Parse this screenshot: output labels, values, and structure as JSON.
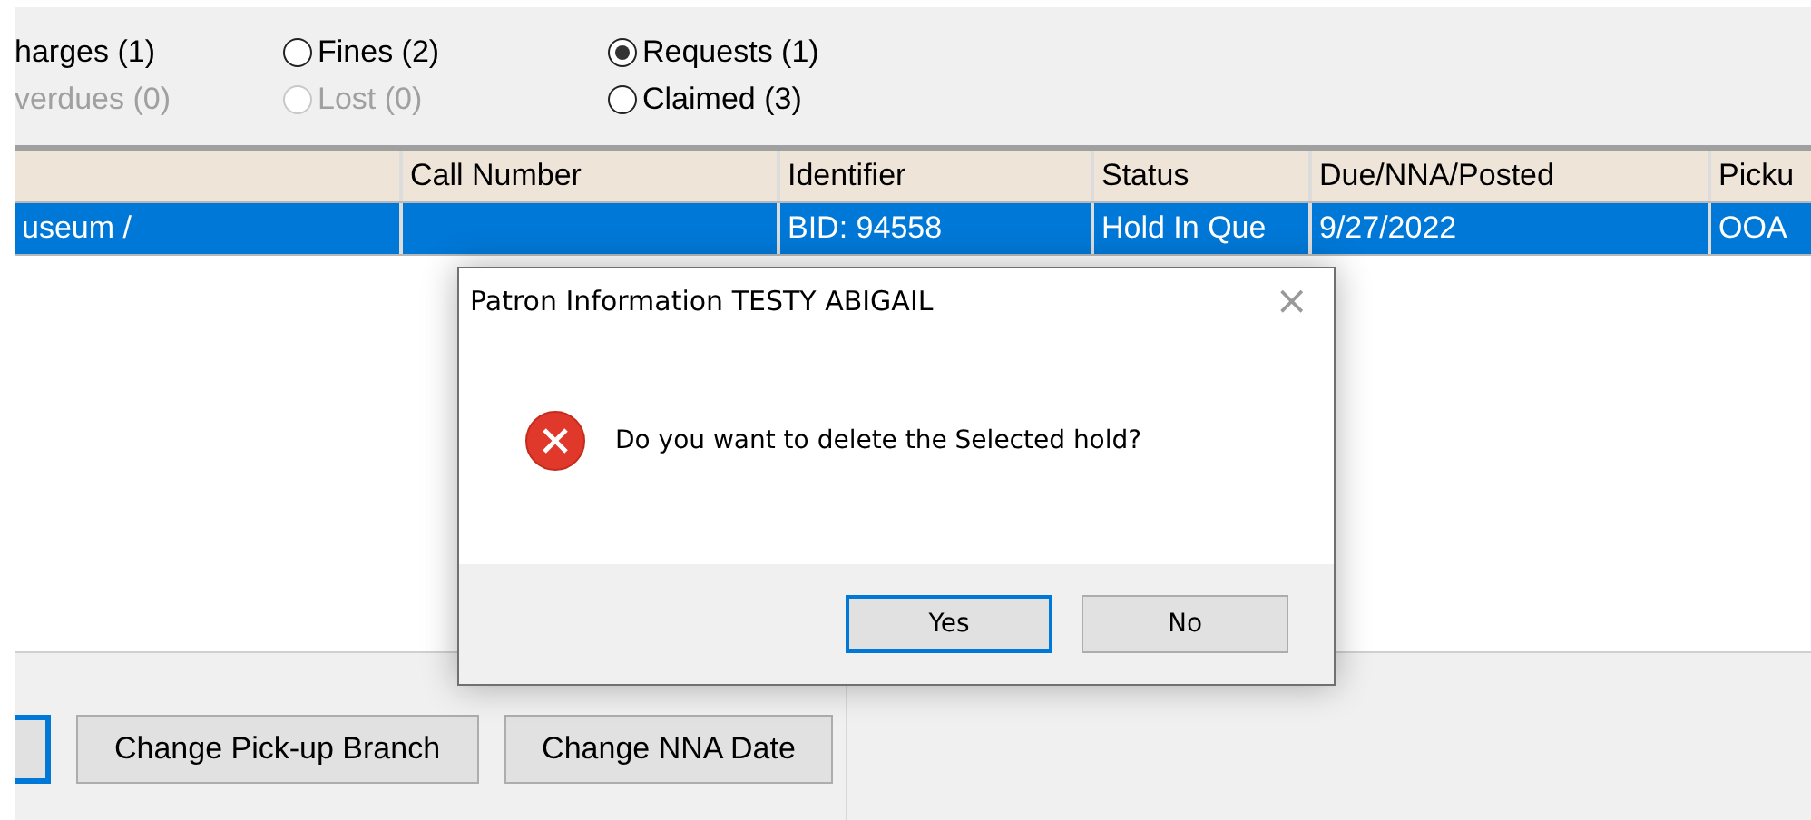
{
  "filters": [
    {
      "label": "harges (1)",
      "kind": "clipped",
      "disabled": false
    },
    {
      "label": "verdues (0)",
      "kind": "clipped",
      "disabled": true
    },
    {
      "label": "Fines (2)",
      "kind": "radio",
      "selected": false,
      "disabled": false
    },
    {
      "label": "Lost (0)",
      "kind": "radio",
      "selected": false,
      "disabled": true
    },
    {
      "label": "Requests (1)",
      "kind": "radio",
      "selected": true,
      "disabled": false
    },
    {
      "label": "Claimed (3)",
      "kind": "radio",
      "selected": false,
      "disabled": false
    }
  ],
  "table": {
    "columns": [
      "",
      "Call Number",
      "Identifier",
      "Status",
      "Due/NNA/Posted",
      "Picku"
    ],
    "rows": [
      {
        "selected": true,
        "cells": [
          "useum /",
          "",
          "BID: 94558",
          "Hold In Que",
          "9/27/2022",
          "OOA"
        ]
      }
    ]
  },
  "actions": [
    {
      "focused": true
    },
    {
      "label": "Change Pick-up Branch",
      "focused": false
    },
    {
      "label": "Change NNA Date",
      "focused": false
    }
  ],
  "dialog": {
    "title": "Patron Information TESTY ABIGAIL",
    "close": "×",
    "message": "Do you want to delete the Selected hold?",
    "buttons": [
      {
        "label": "Yes",
        "default": true
      },
      {
        "label": "No",
        "default": false
      }
    ]
  }
}
